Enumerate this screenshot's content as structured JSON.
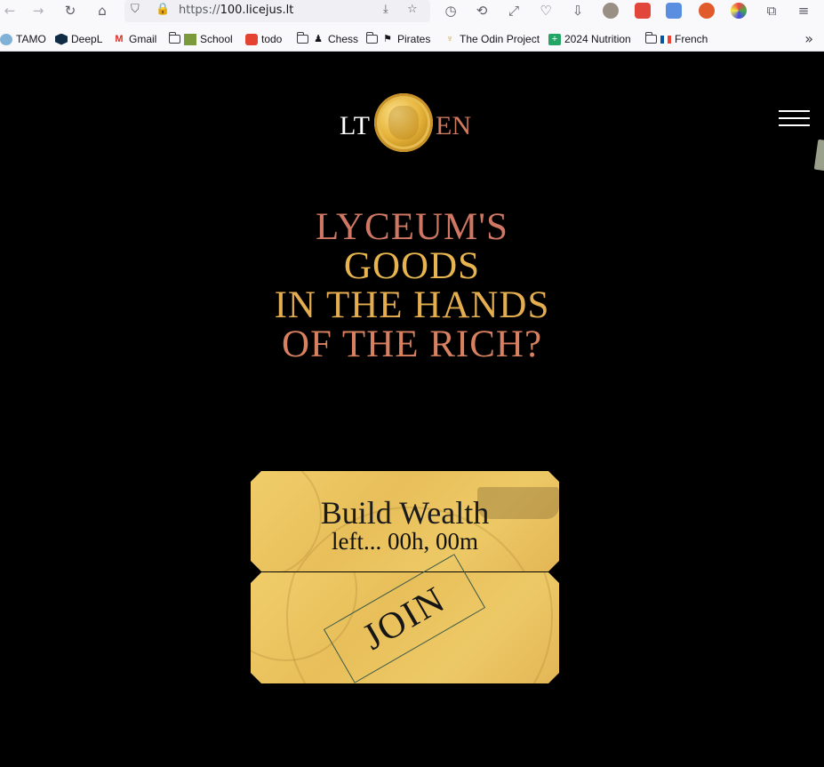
{
  "browser": {
    "url_scheme": "https://",
    "url_host": "100.licejus.lt",
    "bookmarks": [
      {
        "label": "TAMO",
        "icon": "tamo-icon"
      },
      {
        "label": "DeepL",
        "icon": "deepl-icon"
      },
      {
        "label": "Gmail",
        "icon": "gmail-icon"
      },
      {
        "label": "School",
        "icon": "folder-icon"
      },
      {
        "label": "todo",
        "icon": "todoist-icon"
      },
      {
        "label": "Chess",
        "icon": "folder-icon"
      },
      {
        "label": "Pirates",
        "icon": "folder-icon"
      },
      {
        "label": "The Odin Project",
        "icon": "odin-icon"
      },
      {
        "label": "2024 Nutrition",
        "icon": "sheets-icon"
      },
      {
        "label": "French",
        "icon": "folder-icon"
      }
    ]
  },
  "header": {
    "lang_lt": "LT",
    "lang_en": "EN",
    "logo_icon": "gold-coin-icon",
    "menu_icon": "hamburger-icon"
  },
  "hero": {
    "line1": "LYCEUM'S",
    "line2": "GOODS",
    "line3": "IN THE HANDS",
    "line4": "OF THE RICH?"
  },
  "ticket": {
    "title": "Build Wealth",
    "timer": "left... 00h, 00m",
    "join_label": "JOIN"
  },
  "colors": {
    "background": "#000000",
    "gold": "#e8bf5a",
    "salmon": "#cf7763",
    "amber": "#e7b44f"
  }
}
